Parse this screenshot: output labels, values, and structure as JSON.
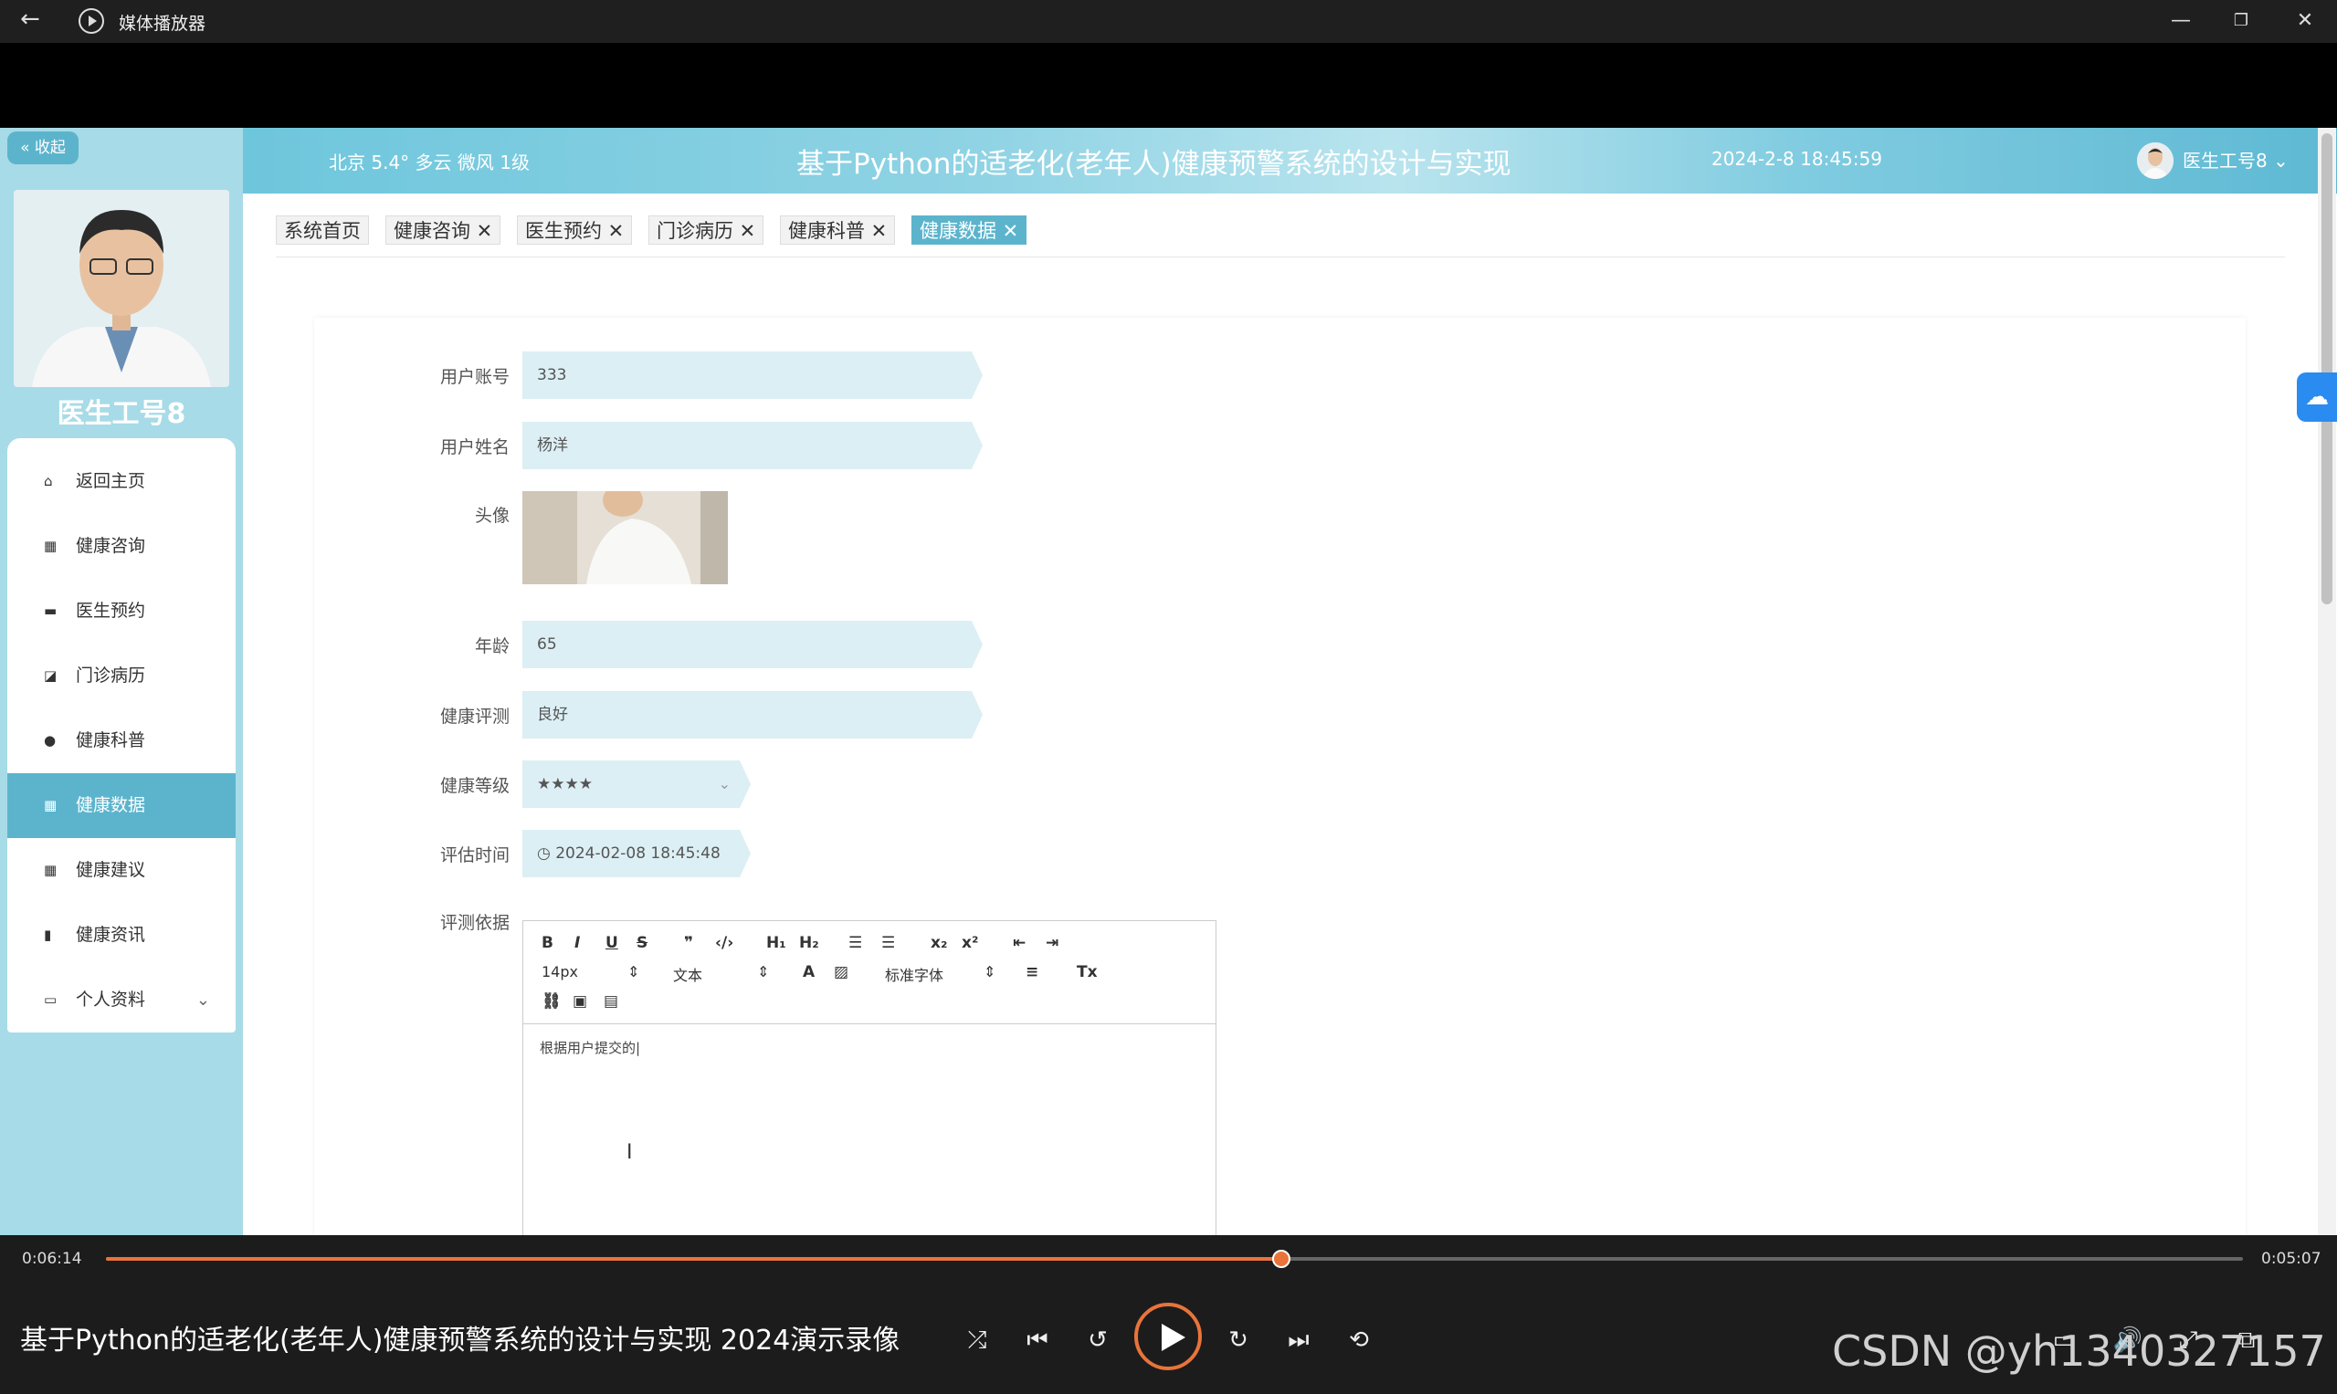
{
  "window": {
    "title": "媒体播放器"
  },
  "sidebar": {
    "collapse_label": "« 收起",
    "doctor_name": "医生工号8",
    "items": [
      {
        "label": "返回主页",
        "icon": "home-icon"
      },
      {
        "label": "健康咨询",
        "icon": "grid-icon"
      },
      {
        "label": "医生预约",
        "icon": "monitor-icon"
      },
      {
        "label": "门诊病历",
        "icon": "chart-icon"
      },
      {
        "label": "健康科普",
        "icon": "pin-icon"
      },
      {
        "label": "健康数据",
        "icon": "grid-icon",
        "active": true
      },
      {
        "label": "健康建议",
        "icon": "grid-icon"
      },
      {
        "label": "健康资讯",
        "icon": "bar-chart-icon"
      },
      {
        "label": "个人资料",
        "icon": "card-icon"
      }
    ]
  },
  "header": {
    "weather": "北京  5.4°  多云  微风  1级",
    "title": "基于Python的适老化(老年人)健康预警系统的设计与实现",
    "datetime": "2024-2-8 18:45:59",
    "user": "医生工号8 ⌄"
  },
  "tabs": [
    {
      "label": "系统首页"
    },
    {
      "label": "健康咨询 ✕"
    },
    {
      "label": "医生预约 ✕"
    },
    {
      "label": "门诊病历 ✕"
    },
    {
      "label": "健康科普 ✕"
    },
    {
      "label": "健康数据 ✕",
      "active": true
    }
  ],
  "form": {
    "account_label": "用户账号",
    "account_value": "333",
    "name_label": "用户姓名",
    "name_value": "杨洋",
    "avatar_label": "头像",
    "age_label": "年龄",
    "age_value": "65",
    "eval_label": "健康评测",
    "eval_value": "良好",
    "level_label": "健康等级",
    "level_value": "★★★★",
    "time_label": "评估时间",
    "time_value": "◷  2024-02-08 18:45:48",
    "basis_label": "评测依据",
    "editor": {
      "font_size": "14px",
      "text_style": "文本",
      "font_family": "标准字体",
      "content": "根据用户提交的|"
    }
  },
  "player": {
    "elapsed": "0:06:14",
    "remaining": "0:05:07",
    "progress": 0.55,
    "video_title": "基于Python的适老化(老年人)健康预警系统的设计与实现 2024演示录像",
    "watermark": "CSDN @yh1340327157"
  }
}
